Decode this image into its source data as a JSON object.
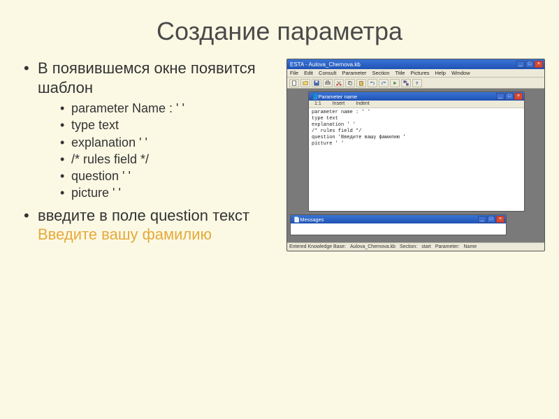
{
  "slide": {
    "title": "Создание параметра",
    "bullets": [
      {
        "text": "В появившемся окне появится шаблон",
        "children": [
          "parameter Name : ' '",
          "type text",
          "explanation ' '",
          "/* rules field */",
          "question ' '",
          "picture ' '"
        ]
      },
      {
        "text_prefix": "введите в поле question текст ",
        "text_highlight": "Введите вашу фамилию"
      }
    ]
  },
  "app": {
    "title": "ESTA - Aulova_Chernova.kb",
    "menu": [
      "File",
      "Edit",
      "Consult",
      "Parameter",
      "Section",
      "Title",
      "Pictures",
      "Help",
      "Window"
    ],
    "editor": {
      "title": "Parameter name",
      "header": {
        "pos": "1:1",
        "col_insert": "Insert",
        "col_indent": "Indent"
      },
      "lines": [
        "parameter name : ' '",
        "type text",
        "explanation ' '",
        "/* rules field */",
        "question 'Введите вашу фамилию '",
        "picture ' '"
      ]
    },
    "messages": {
      "title": "Messages"
    },
    "status": {
      "kb_label": "Entered Knowledge Base:",
      "kb_value": "Aulova_Chernova.kb",
      "section_label": "Section:",
      "section_value": "start",
      "parameter_label": "Parameter:",
      "parameter_value": "Name"
    }
  }
}
